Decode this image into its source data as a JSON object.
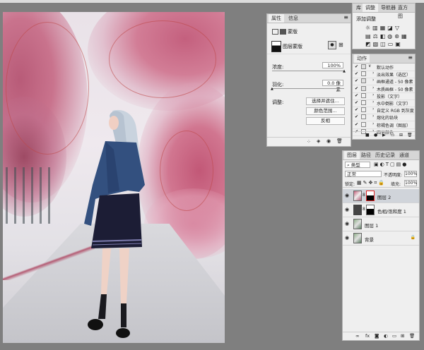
{
  "properties_panel": {
    "tabs": [
      "属性",
      "信息"
    ],
    "type_label": "蒙版",
    "layer_mask_label": "图层蒙版",
    "density_label": "浓度:",
    "density_value": "100%",
    "feather_label": "羽化:",
    "feather_value": "0.0 像素",
    "adjust_label": "调整:",
    "buttons": [
      "选择并遮住...",
      "颜色范围...",
      "反相"
    ]
  },
  "adjustments_panel": {
    "tabs": [
      "库",
      "调整",
      "导航器",
      "直方图"
    ],
    "title": "添加调整"
  },
  "actions_panel": {
    "tabs": [
      "动作"
    ],
    "items": [
      {
        "label": "默认动作",
        "folder": true
      },
      {
        "label": "淡出效果（选区）"
      },
      {
        "label": "画框通道 - 50 像素"
      },
      {
        "label": "木质画框 - 50 像素"
      },
      {
        "label": "投影（文字）"
      },
      {
        "label": "水中倒影（文字）"
      },
      {
        "label": "自定义 RGB 到灰度"
      },
      {
        "label": "熔化的铅块"
      },
      {
        "label": "棕褐色调（图层）"
      },
      {
        "label": "四分颜色"
      }
    ]
  },
  "layers_panel": {
    "tabs": [
      "图层",
      "路径",
      "历史记录",
      "通道"
    ],
    "kind_label": "类型",
    "blend_mode": "正常",
    "opacity_label": "不透明度:",
    "opacity_value": "100%",
    "lock_label": "锁定:",
    "fill_label": "填充:",
    "fill_value": "100%",
    "layers": [
      {
        "name": "图层 2"
      },
      {
        "name": "色相/饱和度 1"
      },
      {
        "name": "图层 1"
      },
      {
        "name": "背景"
      }
    ]
  }
}
